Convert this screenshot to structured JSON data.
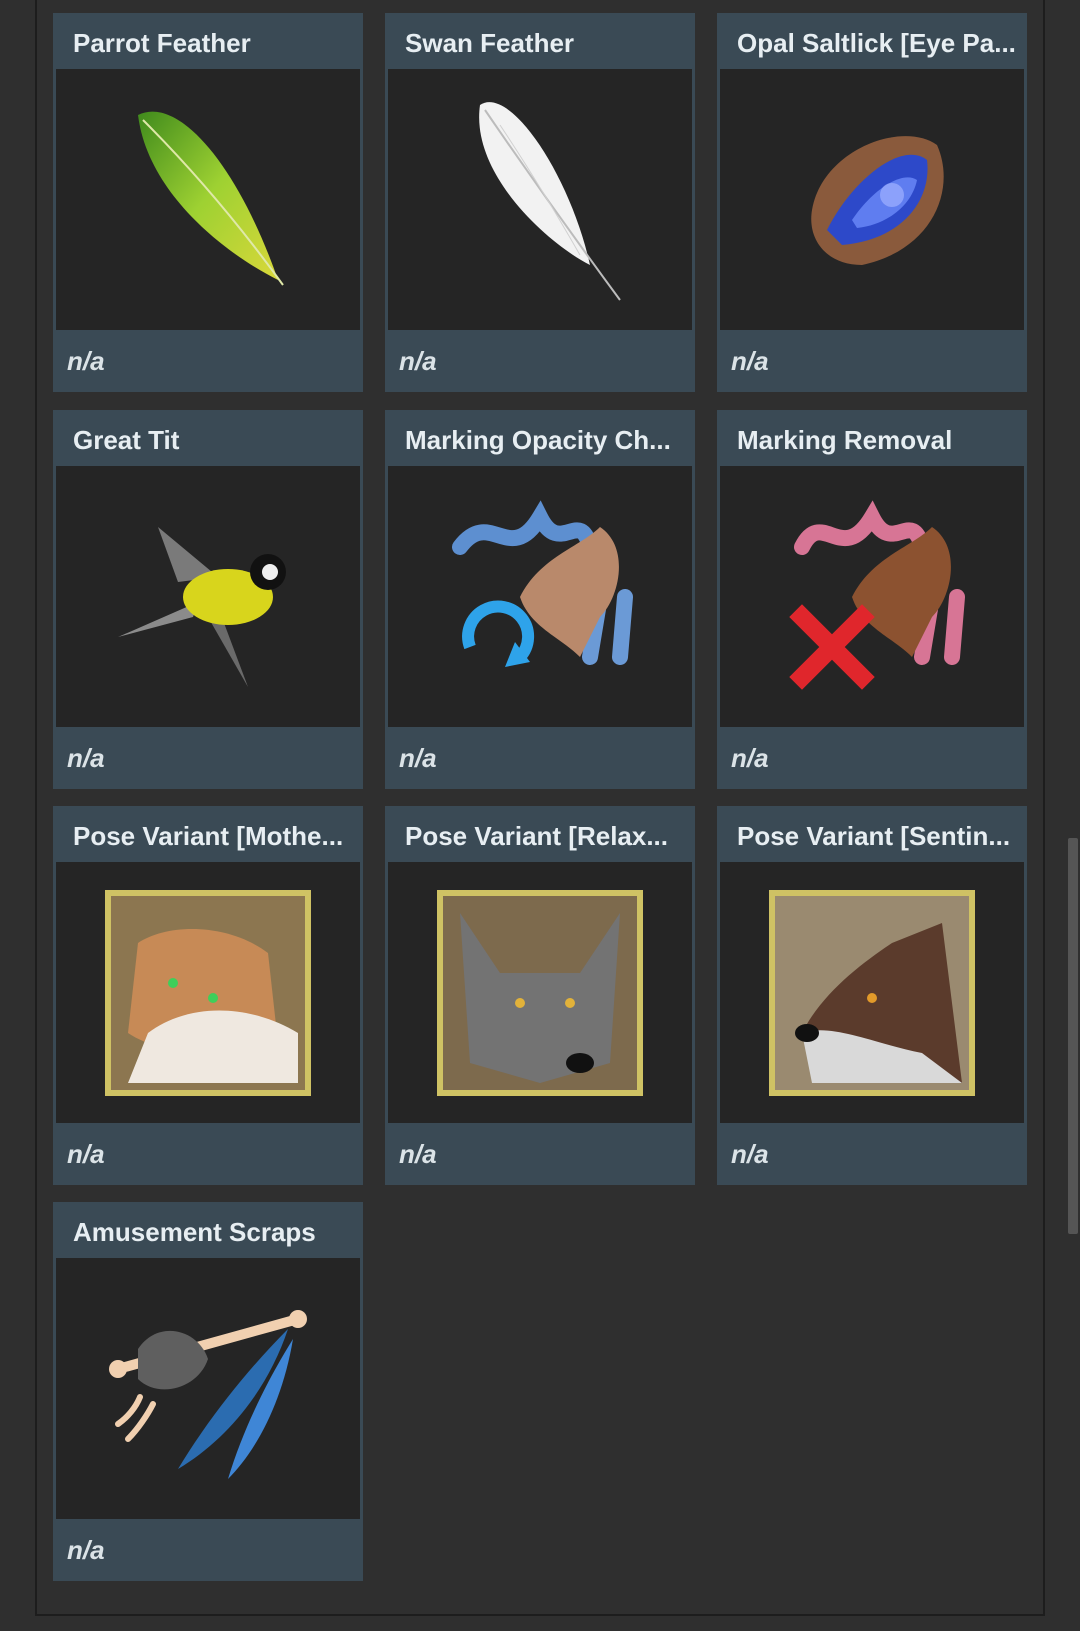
{
  "items": [
    {
      "title": "Parrot Feather",
      "price": "n/a",
      "icon": "parrot-feather-icon"
    },
    {
      "title": "Swan Feather",
      "price": "n/a",
      "icon": "swan-feather-icon"
    },
    {
      "title": "Opal Saltlick [Eye Pa...",
      "price": "n/a",
      "icon": "opal-saltlick-icon"
    },
    {
      "title": "Great Tit",
      "price": "n/a",
      "icon": "great-tit-bird-icon"
    },
    {
      "title": "Marking Opacity Ch...",
      "price": "n/a",
      "icon": "marking-opacity-change-icon"
    },
    {
      "title": "Marking Removal",
      "price": "n/a",
      "icon": "marking-removal-icon"
    },
    {
      "title": "Pose Variant [Mothe...",
      "price": "n/a",
      "icon": "pose-variant-mother-icon"
    },
    {
      "title": "Pose Variant [Relax...",
      "price": "n/a",
      "icon": "pose-variant-relaxed-icon"
    },
    {
      "title": "Pose Variant [Sentin...",
      "price": "n/a",
      "icon": "pose-variant-sentinel-icon"
    },
    {
      "title": "Amusement Scraps",
      "price": "n/a",
      "icon": "amusement-scraps-icon"
    }
  ]
}
